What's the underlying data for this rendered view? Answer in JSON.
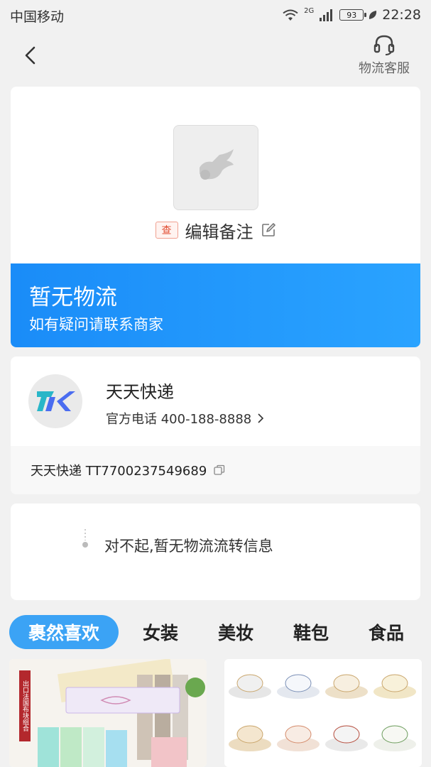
{
  "status_bar": {
    "carrier": "中国移动",
    "network": "2G",
    "battery": "93",
    "time": "22:28"
  },
  "nav": {
    "service_label": "物流客服"
  },
  "package": {
    "tag": "查",
    "remark": "编辑备注",
    "status_title": "暂无物流",
    "status_subtitle": "如有疑问请联系商家"
  },
  "courier": {
    "name": "天天快递",
    "phone": "官方电话 400-188-8888",
    "tracking": "天天快递 TT7700237549689"
  },
  "info": {
    "message": "对不起,暂无物流流转信息"
  },
  "tabs": [
    {
      "label": "裹然喜欢",
      "active": true
    },
    {
      "label": "女装",
      "active": false
    },
    {
      "label": "美妆",
      "active": false
    },
    {
      "label": "鞋包",
      "active": false
    },
    {
      "label": "食品",
      "active": false
    }
  ],
  "products": [
    {
      "badge": "出口法国布块组合"
    },
    {
      "badge": ""
    }
  ],
  "colors": {
    "banner_blue": "#1a8cf8",
    "tab_active": "#3ba3f5",
    "tag_red": "#e04a2e"
  }
}
